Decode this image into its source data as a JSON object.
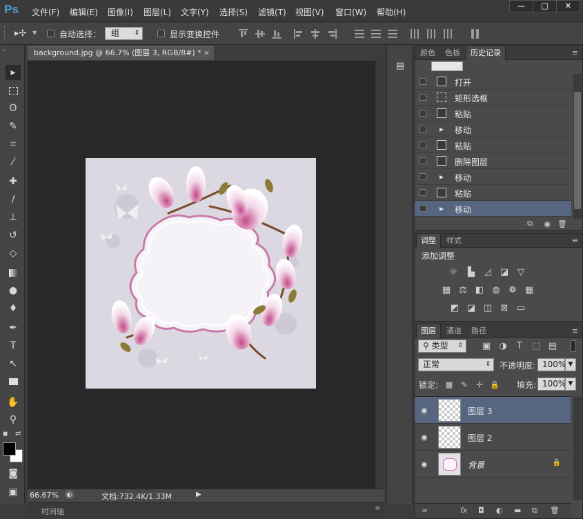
{
  "app": {
    "logo": "Ps"
  },
  "menu": [
    "文件(F)",
    "编辑(E)",
    "图像(I)",
    "图层(L)",
    "文字(Y)",
    "选择(S)",
    "滤镜(T)",
    "视图(V)",
    "窗口(W)",
    "帮助(H)"
  ],
  "window_controls": {
    "minimize": "—",
    "restore": "□",
    "close": "✕"
  },
  "options_bar": {
    "auto_select_label": "自动选择：",
    "auto_select_value": "组",
    "show_transform_label": "显示变换控件"
  },
  "document": {
    "tab_title": "background.jpg @ 66.7% (图层 3, RGB/8#) *",
    "tab_close": "×"
  },
  "status": {
    "zoom": "66.67%",
    "doc_size": "文档:732.4K/1.33M"
  },
  "timeline": {
    "label": "时间轴"
  },
  "history_panel": {
    "tabs": [
      "颜色",
      "色板",
      "历史记录"
    ],
    "active_tab": "历史记录",
    "items": [
      {
        "label": "打开",
        "icon": "document-icon"
      },
      {
        "label": "矩形选框",
        "icon": "marquee-icon"
      },
      {
        "label": "粘贴",
        "icon": "document-icon"
      },
      {
        "label": "移动",
        "icon": "move-icon"
      },
      {
        "label": "粘贴",
        "icon": "document-icon"
      },
      {
        "label": "删除图层",
        "icon": "document-icon"
      },
      {
        "label": "移动",
        "icon": "move-icon"
      },
      {
        "label": "粘贴",
        "icon": "document-icon"
      },
      {
        "label": "移动",
        "icon": "move-icon"
      }
    ],
    "selected_index": 8
  },
  "adjustments_panel": {
    "tabs": [
      "调整",
      "样式"
    ],
    "active_tab": "调整",
    "heading": "添加调整"
  },
  "layers_panel": {
    "tabs": [
      "图层",
      "通道",
      "路径"
    ],
    "active_tab": "图层",
    "filter_label": "类型",
    "blend_mode": "正常",
    "opacity_label": "不透明度:",
    "opacity_value": "100%",
    "lock_label": "锁定:",
    "fill_label": "填充:",
    "fill_value": "100%",
    "layers": [
      {
        "name": "图层 3",
        "selected": true
      },
      {
        "name": "图层 2",
        "selected": false
      },
      {
        "name": "背景",
        "selected": false,
        "locked": true
      }
    ]
  },
  "colors": {
    "selection_blue": "#566580",
    "ps_logo_blue": "#4aa3e0",
    "canvas_bg": "#282828",
    "image_bg": "#dcd8e2"
  }
}
